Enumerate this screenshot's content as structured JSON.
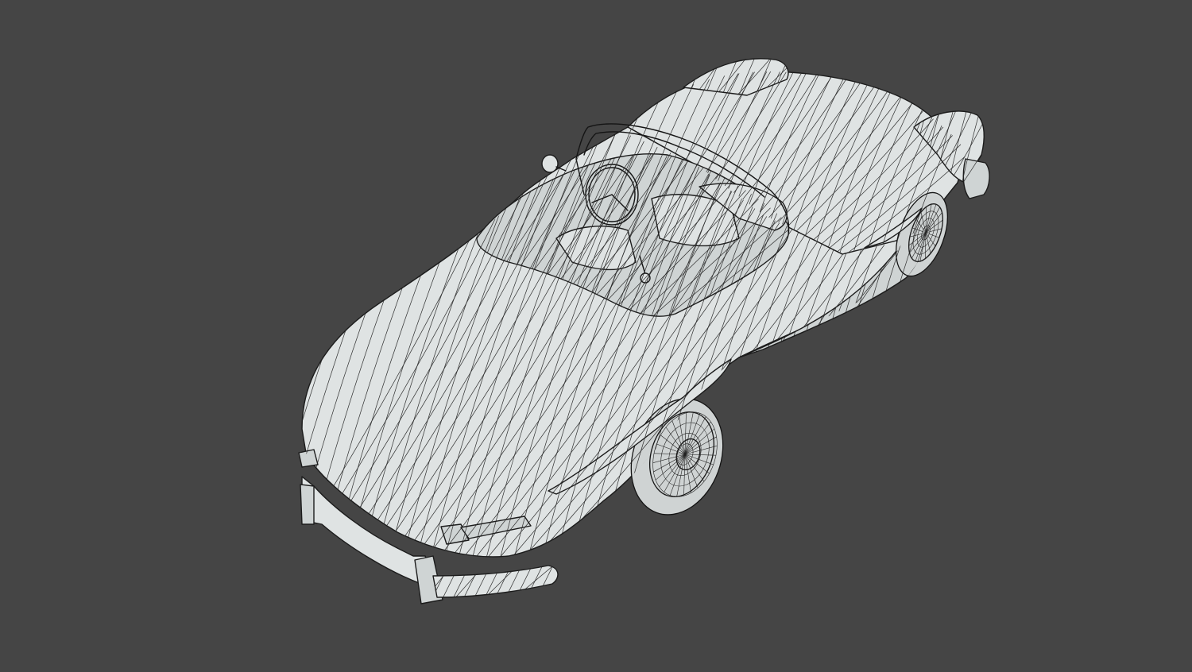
{
  "viewport": {
    "background_color": "#454545",
    "model_fill_color": "#dfe3e3",
    "wire_color": "#1c1c1c",
    "display_mode": "wireframe-on-shaded"
  },
  "model": {
    "subject": "vintage-roadster-convertible"
  }
}
